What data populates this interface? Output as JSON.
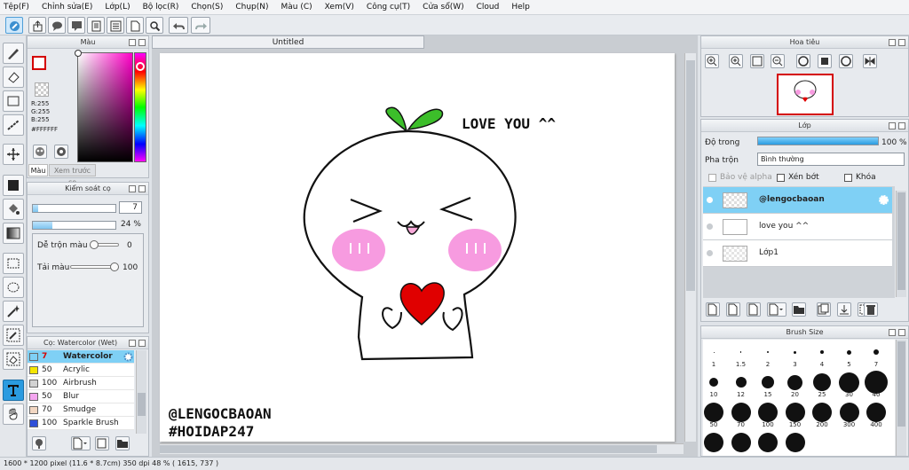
{
  "menu": [
    "Tệp(F)",
    "Chỉnh sửa(E)",
    "Lớp(L)",
    "Bộ lọc(R)",
    "Chọn(S)",
    "Chụp(N)",
    "Màu (C)",
    "Xem(V)",
    "Công cụ(T)",
    "Cửa sổ(W)",
    "Cloud",
    "Help"
  ],
  "document": {
    "tab_title": "Untitled"
  },
  "artwork": {
    "speech": "LOVE YOU ^^",
    "watermark_line1": "@LENGOCBAOAN",
    "watermark_line2": "#HOIDAP247"
  },
  "color_panel": {
    "title": "Màu",
    "r": "R:255",
    "g": "G:255",
    "b": "B:255",
    "hex": "#FFFFFF",
    "tab_color": "Màu",
    "tab_preview": "Xem trước cọ",
    "fg_color": "#ffffff",
    "border_color": "#d40000"
  },
  "brush_control": {
    "title": "Kiểm soát cọ",
    "size_value": "7",
    "opacity_value": "24 %",
    "opacity_fraction": 0.24,
    "blend_label": "Dễ trộn màu",
    "blend_value": "0",
    "load_label": "Tải màu",
    "load_value": "100"
  },
  "brush_list": {
    "title": "Cọ: Watercolor (Wet)",
    "items": [
      {
        "size": "7",
        "name": "Watercolor (Wet)",
        "color": "#7fd0f5"
      },
      {
        "size": "50",
        "name": "Acrylic",
        "color": "#f4e600"
      },
      {
        "size": "100",
        "name": "Airbrush",
        "color": "#d2d2d2"
      },
      {
        "size": "50",
        "name": "Blur",
        "color": "#f4a6f0"
      },
      {
        "size": "70",
        "name": "Smudge",
        "color": "#f2d7c2"
      },
      {
        "size": "100",
        "name": "Sparkle Brush",
        "color": "#2f4fd8"
      }
    ]
  },
  "navigator": {
    "title": "Hoa tiêu"
  },
  "layers": {
    "title": "Lớp",
    "opacity_label": "Độ trong",
    "opacity_value": "100 %",
    "opacity_fraction": 1.0,
    "blend_label": "Pha trộn",
    "blend_value": "Bình thường",
    "protect_alpha": "Bảo vệ alpha",
    "clipping": "Xén bớt",
    "lock": "Khóa",
    "items": [
      {
        "name": "@lengocbaoan",
        "selected": true
      },
      {
        "name": "love you ^^",
        "selected": false
      },
      {
        "name": "Lớp1",
        "selected": false
      }
    ]
  },
  "brush_size": {
    "title": "Brush Size",
    "sizes": [
      "1",
      "1.5",
      "2",
      "3",
      "4",
      "5",
      "7",
      "10",
      "12",
      "15",
      "20",
      "25",
      "30",
      "40",
      "50",
      "70",
      "100",
      "150",
      "200",
      "300",
      "400",
      "",
      "",
      "",
      ""
    ]
  },
  "status": {
    "text": "1600 * 1200 pixel  (11.6 * 8.7cm)  350 dpi  48 %  ( 1615, 737 )"
  }
}
